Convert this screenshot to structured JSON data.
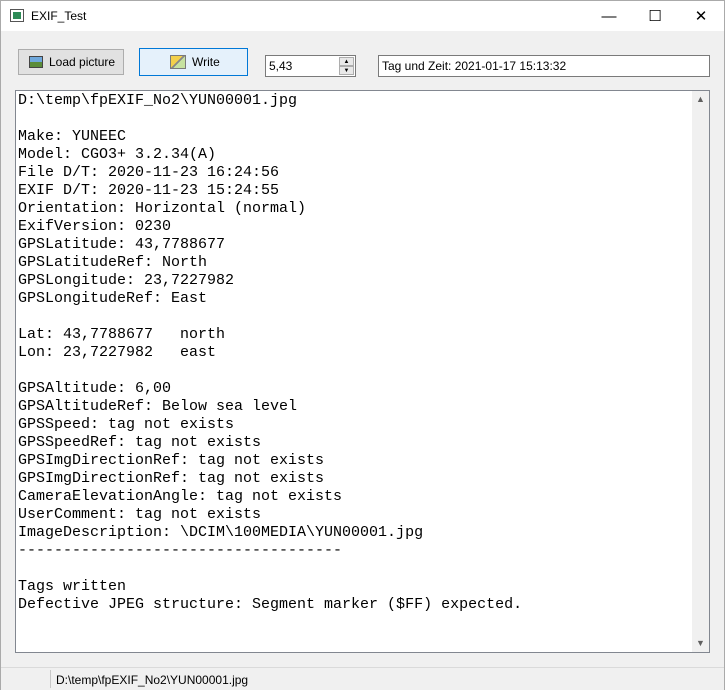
{
  "window": {
    "title": "EXIF_Test",
    "controls": {
      "minimize": "—",
      "maximize": "☐",
      "close": "✕"
    }
  },
  "toolbar": {
    "load_label": "Load picture",
    "load_icon": "picture-icon",
    "write_label": "Write",
    "write_icon": "pencil-icon",
    "spin_value": "5,43",
    "tag_value": "Tag und Zeit: 2021-01-17 15:13:32"
  },
  "memo": {
    "lines": [
      "D:\\temp\\fpEXIF_No2\\YUN00001.jpg",
      "",
      "Make: YUNEEC",
      "Model: CGO3+ 3.2.34(A)",
      "File D/T: 2020-11-23 16:24:56",
      "EXIF D/T: 2020-11-23 15:24:55",
      "Orientation: Horizontal (normal)",
      "ExifVersion: 0230",
      "GPSLatitude: 43,7788677",
      "GPSLatitudeRef: North",
      "GPSLongitude: 23,7227982",
      "GPSLongitudeRef: East",
      "",
      "Lat: 43,7788677   north",
      "Lon: 23,7227982   east",
      "",
      "GPSAltitude: 6,00",
      "GPSAltitudeRef: Below sea level",
      "GPSSpeed: tag not exists",
      "GPSSpeedRef: tag not exists",
      "GPSImgDirectionRef: tag not exists",
      "GPSImgDirectionRef: tag not exists",
      "CameraElevationAngle: tag not exists",
      "UserComment: tag not exists",
      "ImageDescription: \\DCIM\\100MEDIA\\YUN00001.jpg",
      "------------------------------------",
      "",
      "Tags written",
      "Defective JPEG structure: Segment marker ($FF) expected."
    ]
  },
  "statusbar": {
    "path": "D:\\temp\\fpEXIF_No2\\YUN00001.jpg"
  }
}
